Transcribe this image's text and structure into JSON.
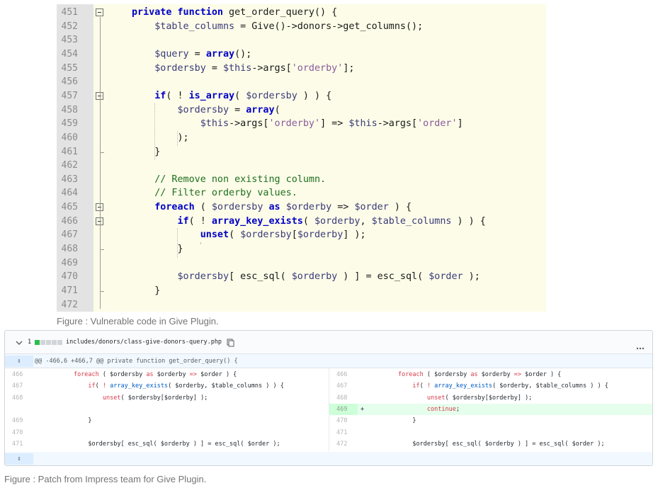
{
  "editor": {
    "lines": [
      {
        "n": "451",
        "html": "<span class=\"kw\">private function</span> get_order_query() {"
      },
      {
        "n": "452",
        "html": "    <span class=\"var\">$table_columns</span> = Give()-&gt;donors-&gt;get_columns();"
      },
      {
        "n": "453",
        "html": ""
      },
      {
        "n": "454",
        "html": "    <span class=\"var\">$query</span> = <span class=\"kw\">array</span>();"
      },
      {
        "n": "455",
        "html": "    <span class=\"var\">$ordersby</span> = <span class=\"var\">$this</span>-&gt;args[<span class=\"str\">'orderby'</span>];"
      },
      {
        "n": "456",
        "html": ""
      },
      {
        "n": "457",
        "html": "    <span class=\"kw\">if</span>( ! <span class=\"kw\">is_array</span>( <span class=\"var\">$ordersby</span> ) ) {"
      },
      {
        "n": "458",
        "html": "        <span class=\"var\">$ordersby</span> = <span class=\"kw\">array</span>("
      },
      {
        "n": "459",
        "html": "            <span class=\"var\">$this</span>-&gt;args[<span class=\"str\">'orderby'</span>] =&gt; <span class=\"var\">$this</span>-&gt;args[<span class=\"str\">'order'</span>]"
      },
      {
        "n": "460",
        "html": "        );"
      },
      {
        "n": "461",
        "html": "    }"
      },
      {
        "n": "462",
        "html": ""
      },
      {
        "n": "463",
        "html": "    <span class=\"cm\">// Remove non existing column.</span>"
      },
      {
        "n": "464",
        "html": "    <span class=\"cm\">// Filter orderby values.</span>"
      },
      {
        "n": "465",
        "html": "    <span class=\"kw\">foreach</span> ( <span class=\"var\">$ordersby</span> <span class=\"kw\">as</span> <span class=\"var\">$orderby</span> =&gt; <span class=\"var\">$order</span> ) {"
      },
      {
        "n": "466",
        "html": "        <span class=\"kw\">if</span>( ! <span class=\"kw\">array_key_exists</span>( <span class=\"var\">$orderby</span>, <span class=\"var\">$table_columns</span> ) ) {"
      },
      {
        "n": "467",
        "html": "            <span class=\"kw\">unset</span>( <span class=\"var\">$ordersby</span>[<span class=\"var\">$orderby</span>] );"
      },
      {
        "n": "468",
        "html": "        }"
      },
      {
        "n": "469",
        "html": ""
      },
      {
        "n": "470",
        "html": "        <span class=\"var\">$ordersby</span>[ esc_sql( <span class=\"var\">$orderby</span> ) ] = esc_sql( <span class=\"var\">$order</span> );"
      },
      {
        "n": "471",
        "html": "    }"
      },
      {
        "n": "472",
        "html": ""
      }
    ]
  },
  "caption1": "Figure : Vulnerable code in Give Plugin.",
  "diff": {
    "collapse_icon": "chevron-down-icon",
    "changes_count": "1",
    "file_path": "includes/donors/class-give-donors-query.php",
    "copy_icon": "copy-icon",
    "more_icon": "more-horizontal-icon",
    "hunk_header": "@@ -466,6 +466,7 @@ private function get_order_query() {",
    "expand_icon": "expand-icon",
    "rows": [
      {
        "ln": "466",
        "code": "        foreach ( $ordersby as $orderby => $order ) {",
        "rn": "466",
        "rcode": "        foreach ( $ordersby as $orderby => $order ) {",
        "added": false
      },
      {
        "ln": "467",
        "code": "            if( ! array_key_exists( $orderby, $table_columns ) ) {",
        "rn": "467",
        "rcode": "            if( ! array_key_exists( $orderby, $table_columns ) ) {",
        "added": false
      },
      {
        "ln": "468",
        "code": "                unset( $ordersby[$orderby] );",
        "rn": "468",
        "rcode": "                unset( $ordersby[$orderby] );",
        "added": false
      },
      {
        "ln": "",
        "code": "",
        "rn": "469",
        "rcode": "                continue;",
        "added": true,
        "marker": "+"
      },
      {
        "ln": "469",
        "code": "            }",
        "rn": "470",
        "rcode": "            }",
        "added": false
      },
      {
        "ln": "470",
        "code": "",
        "rn": "471",
        "rcode": "",
        "added": false
      },
      {
        "ln": "471",
        "code": "            $ordersby[ esc_sql( $orderby ) ] = esc_sql( $order );",
        "rn": "472",
        "rcode": "            $ordersby[ esc_sql( $orderby ) ] = esc_sql( $order );",
        "added": false
      }
    ]
  },
  "caption2": "Figure  : Patch from Impress team for Give Plugin.",
  "colors": {
    "editor_bg": "#fcfce8",
    "gutter_bg": "#e3e3e3",
    "keyword": "#0000c8",
    "comment": "#1f6f1f",
    "added_bg": "#e6ffed",
    "added_num_bg": "#cdffd8",
    "hunk_bg": "#f1f8ff"
  }
}
